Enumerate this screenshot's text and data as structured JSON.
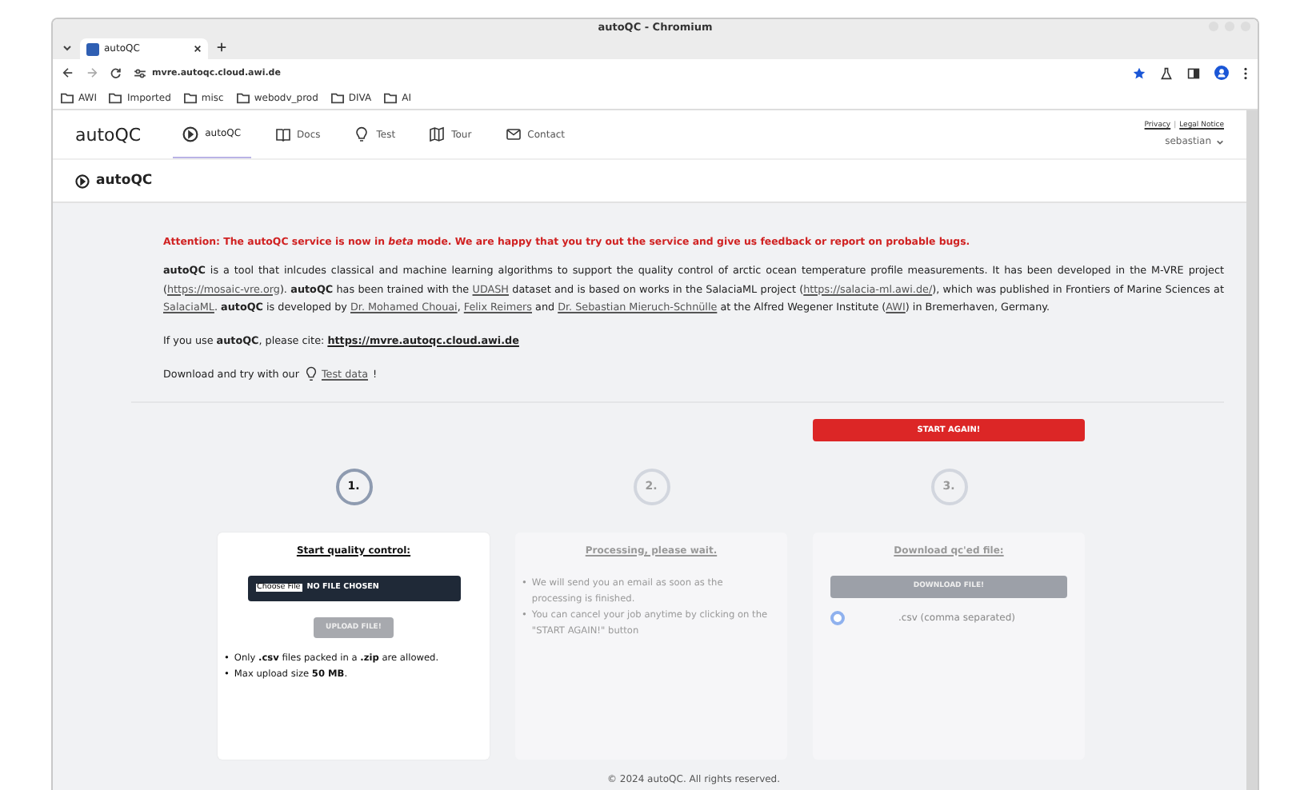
{
  "window": {
    "title": "autoQC - Chromium"
  },
  "browser": {
    "tabs": [
      {
        "label": "autoQC",
        "selected": true
      }
    ],
    "url": "mvre.autoqc.cloud.awi.de",
    "bookmarks": [
      "AWI",
      "Imported",
      "misc",
      "webodv_prod",
      "DIVA",
      "AI"
    ]
  },
  "nav": {
    "brand": "autoQC",
    "items": [
      {
        "label": "autoQC",
        "selected": true
      },
      {
        "label": "Docs",
        "selected": false
      },
      {
        "label": "Test",
        "selected": false
      },
      {
        "label": "Tour",
        "selected": false
      },
      {
        "label": "Contact",
        "selected": false
      }
    ],
    "links": [
      "Privacy",
      "Legal Notice"
    ],
    "separator": "|",
    "user": "sebastian"
  },
  "page_title": "autoQC",
  "notice": "Attention: The autoQC service is now in *beta* mode. We are happy that you try out the service and give us feedback or report on probable bugs.",
  "intro": [
    {
      "kind": "text",
      "text": "**autoQC** is a tool that inlcudes classical and machine learning algorithms to support the quality control of arctic ocean temperature profile measurements. It has been developed in the M-VRE project ("
    },
    {
      "kind": "link",
      "text": "https://mosaic-vre.org"
    },
    {
      "kind": "text",
      "text": "). **autoQC** has been trained with the "
    },
    {
      "kind": "link",
      "text": "UDASH"
    },
    {
      "kind": "text",
      "text": " dataset and is based on works in the SalaciaML project ("
    },
    {
      "kind": "link",
      "text": "https://salacia-ml.awi.de/"
    },
    {
      "kind": "text",
      "text": "), which was published in Frontiers of Marine Sciences at "
    },
    {
      "kind": "link",
      "text": "SalaciaML"
    },
    {
      "kind": "text",
      "text": ". **autoQC** is developed by "
    },
    {
      "kind": "link",
      "text": "Dr. Mohamed Chouai"
    },
    {
      "kind": "text",
      "text": ", "
    },
    {
      "kind": "link",
      "text": "Felix Reimers"
    },
    {
      "kind": "text",
      "text": " and "
    },
    {
      "kind": "link",
      "text": "Dr. Sebastian Mieruch-Schnülle"
    },
    {
      "kind": "text",
      "text": " at the Alfred Wegener Institute ("
    },
    {
      "kind": "link",
      "text": "AWI"
    },
    {
      "kind": "text",
      "text": ") in Bremerhaven, Germany."
    }
  ],
  "cite": [
    {
      "kind": "text",
      "text": "If you use **autoQC**, please cite: "
    },
    {
      "kind": "strong-link",
      "text": "https://mvre.autoqc.cloud.awi.de"
    }
  ],
  "try": {
    "before": "Download and try with our",
    "link": "Test data",
    "after": "!"
  },
  "start_again": "START AGAIN!",
  "steps": [
    {
      "number": "1.",
      "active": true,
      "kind": "upload",
      "title": "Start quality control:",
      "file_button": "Choose File",
      "file_status": "NO FILE CHOSEN",
      "button": {
        "label": "UPLOAD FILE!",
        "disabled": true
      },
      "notes": [
        {
          "bullet": "•",
          "text": "Only **.csv** files packed in a **.zip** are allowed."
        },
        {
          "bullet": "•",
          "text": "Max upload size **50 MB**."
        }
      ]
    },
    {
      "number": "2.",
      "active": false,
      "kind": "processing",
      "title": "Processing, please wait.",
      "notes": [
        {
          "bullet": "•",
          "text": "We will send you an email as soon as the processing is finished."
        },
        {
          "bullet": "•",
          "text": "You can cancel your job anytime by clicking on the \"START AGAIN!\" button"
        }
      ]
    },
    {
      "number": "3.",
      "active": false,
      "kind": "download",
      "title": "Download qc'ed file:",
      "button": {
        "label": "DOWNLOAD FILE!",
        "disabled": true
      },
      "options": [
        {
          "label": ".csv (comma separated)",
          "selected": true
        }
      ]
    }
  ],
  "footer": "© 2024 autoQC. All rights reserved."
}
